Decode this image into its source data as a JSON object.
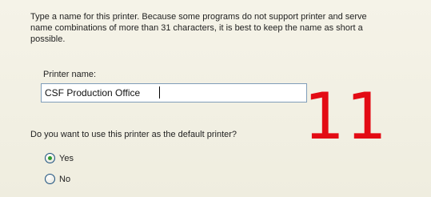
{
  "intro": {
    "line1": "Type a name for this printer. Because some programs do not support printer and serve",
    "line2": "name combinations of more than 31 characters, it is best to keep the name as short a",
    "line3": "possible."
  },
  "printer_name": {
    "label": "Printer name:",
    "value": "CSF Production Office"
  },
  "overlay": {
    "number": "11"
  },
  "default_printer": {
    "question": "Do you want to use this printer as the default printer?",
    "options": [
      {
        "label": "Yes",
        "selected": true
      },
      {
        "label": "No",
        "selected": false
      }
    ]
  },
  "colors": {
    "background": "#f1efe1",
    "input_border": "#7f9db9",
    "overlay_red": "#e30b14",
    "radio_check": "#2f9a2f"
  }
}
